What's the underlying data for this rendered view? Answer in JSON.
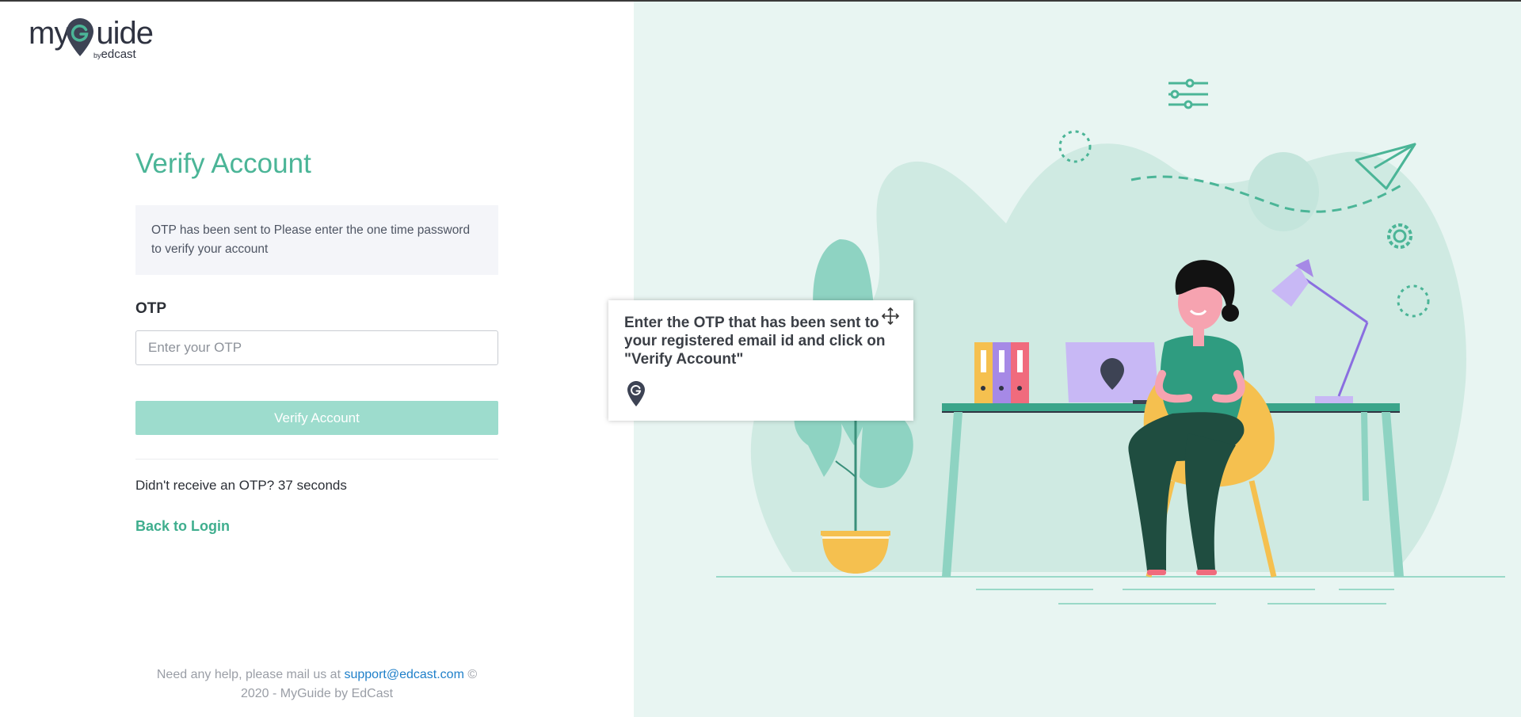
{
  "brand": {
    "name": "myGuide",
    "name_left": "my",
    "name_right": "uide",
    "by_label": "by",
    "sub_label": "edcast"
  },
  "form": {
    "title": "Verify Account",
    "notice": "OTP has been sent to Please enter the one time password to verify your account",
    "otp_label": "OTP",
    "otp_placeholder": "Enter your OTP",
    "otp_value": "",
    "verify_button": "Verify Account",
    "resend_text": "Didn't receive an OTP? 37 seconds",
    "back_link": "Back to Login"
  },
  "footer": {
    "help_prefix": "Need any help, please mail us at ",
    "email": "support@edcast.com",
    "help_suffix": " ©",
    "copyright": "2020 - MyGuide by EdCast"
  },
  "tooltip": {
    "text": "Enter the OTP that has been sent to your registered email id and click on \"Verify Account\"",
    "icon": "myguide-pin-icon"
  },
  "colors": {
    "accent": "#4bb597",
    "button_disabled": "#9ddccd",
    "illustration_bg": "#e8f5f2",
    "link": "#1e7fc9"
  }
}
